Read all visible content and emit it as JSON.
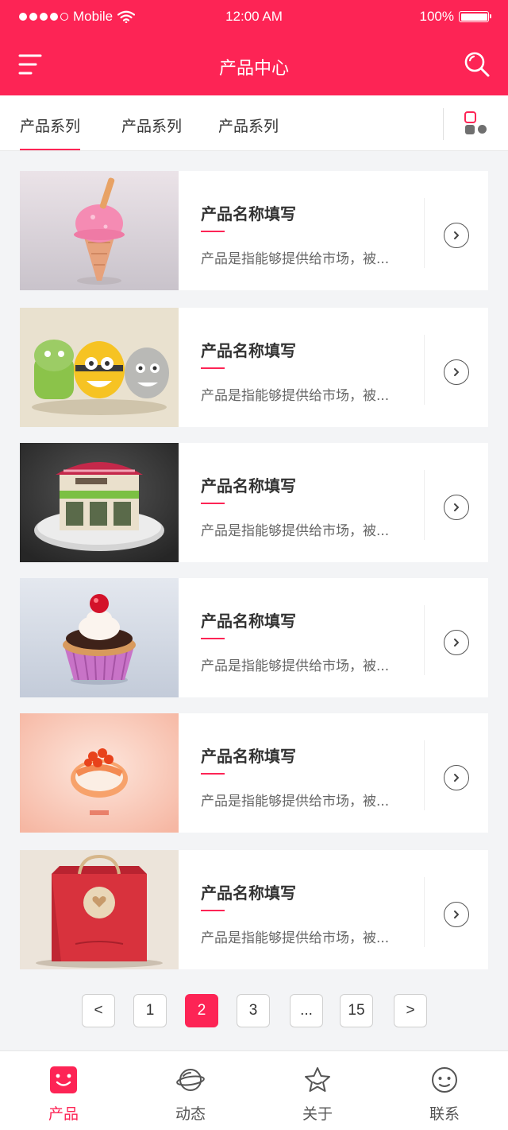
{
  "status_bar": {
    "carrier": "Mobile",
    "time": "12:00 AM",
    "battery": "100%"
  },
  "header": {
    "title": "产品中心"
  },
  "tabs": [
    {
      "label": "产品系列",
      "active": true
    },
    {
      "label": "产品系列",
      "active": false
    },
    {
      "label": "产品系列",
      "active": false
    }
  ],
  "products": [
    {
      "name": "产品名称填写",
      "desc": "产品是指能够提供给市场，被...",
      "image": "ice-cream"
    },
    {
      "name": "产品名称填写",
      "desc": "产品是指能够提供给市场，被...",
      "image": "mascots"
    },
    {
      "name": "产品名称填写",
      "desc": "产品是指能够提供给市场，被...",
      "image": "shop-building"
    },
    {
      "name": "产品名称填写",
      "desc": "产品是指能够提供给市场，被...",
      "image": "cupcake"
    },
    {
      "name": "产品名称填写",
      "desc": "产品是指能够提供给市场，被...",
      "image": "sushi"
    },
    {
      "name": "产品名称填写",
      "desc": "产品是指能够提供给市场，被...",
      "image": "gift-bag"
    }
  ],
  "pagination": {
    "prev": "<",
    "pages": [
      "1",
      "2",
      "3",
      "...",
      "15"
    ],
    "current": "2",
    "next": ">"
  },
  "bottom_nav": [
    {
      "label": "产品",
      "icon": "product-icon",
      "active": true
    },
    {
      "label": "动态",
      "icon": "planet-icon",
      "active": false
    },
    {
      "label": "关于",
      "icon": "star-icon",
      "active": false
    },
    {
      "label": "联系",
      "icon": "smiley-icon",
      "active": false
    }
  ],
  "colors": {
    "accent": "#fd2455",
    "background": "#f3f4f6"
  }
}
